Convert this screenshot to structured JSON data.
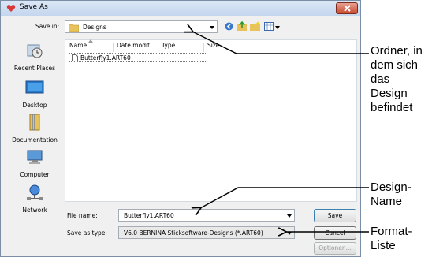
{
  "dialog": {
    "title": "Save As",
    "save_in_label": "Save in:",
    "current_folder": "Designs",
    "places": [
      {
        "label": "Recent Places",
        "icon": "recent-places-icon"
      },
      {
        "label": "Desktop",
        "icon": "desktop-icon"
      },
      {
        "label": "Documentation",
        "icon": "documentation-icon"
      },
      {
        "label": "Computer",
        "icon": "computer-icon"
      },
      {
        "label": "Network",
        "icon": "network-icon"
      }
    ],
    "columns": [
      "Name",
      "Date modif...",
      "Type",
      "Size"
    ],
    "files": [
      {
        "name": "Butterfly1.ART60"
      }
    ],
    "file_name_label": "File name:",
    "file_name_value": "Butterfly1.ART60",
    "save_as_type_label": "Save as type:",
    "save_as_type_value": "V6.0 BERNINA Sticksoftware-Designs (*.ART60)",
    "buttons": {
      "save": "Save",
      "cancel": "Cancel",
      "options": "Optionen..."
    }
  },
  "annotations": {
    "folder_lines": [
      "Ordner, in",
      "dem sich",
      "das",
      "Design",
      "befindet"
    ],
    "name_lines": [
      "Design-",
      "Name"
    ],
    "format_lines": [
      "Format-",
      "Liste"
    ]
  },
  "colors": {
    "titlebar": "#c4d6ee",
    "close_button": "#c84a30",
    "folder": "#e8c25a"
  }
}
